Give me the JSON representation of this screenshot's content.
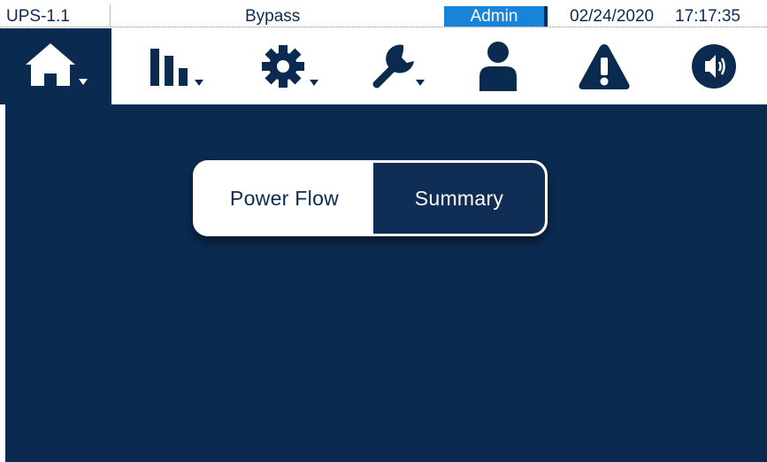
{
  "status_bar": {
    "unit_name": "UPS-1.1",
    "mode": "Bypass",
    "user": "Admin",
    "date": "02/24/2020",
    "time": "17:17:35"
  },
  "nav": {
    "items": [
      {
        "icon": "home-icon",
        "has_dropdown": true,
        "active": true
      },
      {
        "icon": "bar-chart-icon",
        "has_dropdown": true,
        "active": false
      },
      {
        "icon": "gear-icon",
        "has_dropdown": true,
        "active": false
      },
      {
        "icon": "wrench-icon",
        "has_dropdown": true,
        "active": false
      },
      {
        "icon": "user-icon",
        "has_dropdown": false,
        "active": false
      },
      {
        "icon": "alarm-warning-icon",
        "has_dropdown": false,
        "active": false
      },
      {
        "icon": "speaker-icon",
        "has_dropdown": false,
        "active": false
      }
    ]
  },
  "view_toggle": {
    "options": [
      "Power Flow",
      "Summary"
    ],
    "selected": "Summary"
  },
  "colors": {
    "navy": "#0b2a4f",
    "accent_blue": "#1784d8",
    "white": "#ffffff"
  }
}
